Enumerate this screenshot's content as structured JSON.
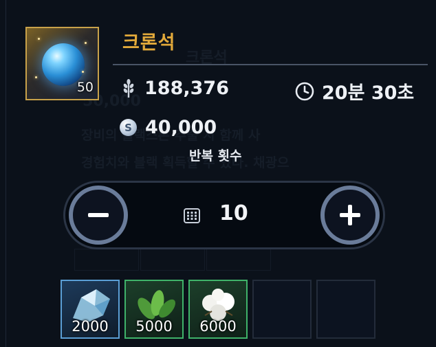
{
  "item": {
    "name": "크론석",
    "count": "50",
    "icon": "blue-crystal-orb-icon",
    "frame_color": "#c9a24a"
  },
  "stats": {
    "wheat_value": "188,376",
    "wheat_icon": "wheat-icon",
    "time_value": "20분 30초",
    "time_icon": "clock-icon",
    "silver_value": "40,000",
    "silver_icon": "silver-coin-icon",
    "silver_symbol": "S"
  },
  "repeat": {
    "label": "반복 횟수",
    "value": "10",
    "minus_icon": "minus-icon",
    "plus_icon": "plus-icon",
    "grid_icon": "keypad-icon"
  },
  "materials": [
    {
      "icon": "ice-crystal-icon",
      "count": "2000",
      "rarity_color": "#5b9fd6"
    },
    {
      "icon": "leaf-icon",
      "count": "5000",
      "rarity_color": "#3fb36a"
    },
    {
      "icon": "cotton-icon",
      "count": "6000",
      "rarity_color": "#3fb36a"
    },
    {
      "icon": "",
      "count": ""
    },
    {
      "icon": "",
      "count": ""
    }
  ],
  "colors": {
    "accent_gold": "#e2a93a",
    "background": "#0b111a"
  }
}
